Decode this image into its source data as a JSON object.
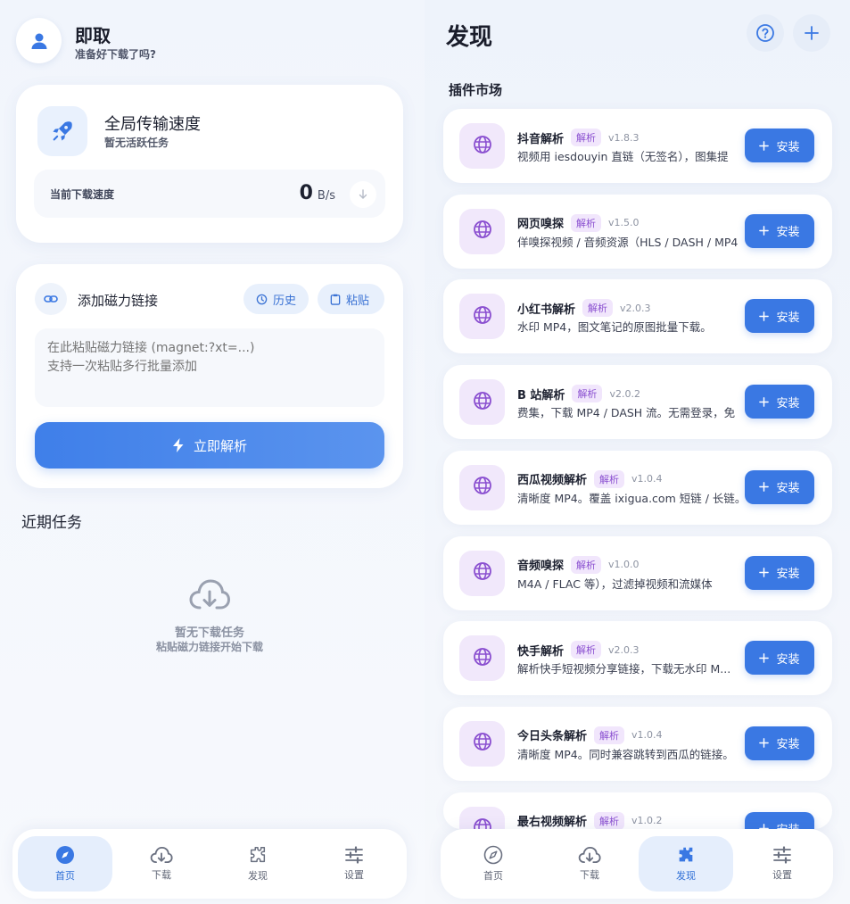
{
  "home": {
    "app_title": "即取",
    "app_subtitle": "准备好下载了吗?",
    "speed_card": {
      "title": "全局传输速度",
      "subtitle": "暂无活跃任务",
      "current_label": "当前下载速度",
      "speed_value": "0",
      "speed_unit": "B/s"
    },
    "magnet_card": {
      "title": "添加磁力链接",
      "history_label": "历史",
      "paste_label": "粘贴",
      "placeholder": "在此粘贴磁力链接 (magnet:?xt=...)\n支持一次粘贴多行批量添加",
      "parse_label": "立即解析"
    },
    "recent_title": "近期任务",
    "empty_main": "暂无下载任务",
    "empty_sub": "粘贴磁力链接开始下载"
  },
  "nav_left": [
    {
      "label": "首页",
      "icon": "compass-icon",
      "active": true
    },
    {
      "label": "下载",
      "icon": "cloud-download-icon",
      "active": false
    },
    {
      "label": "发现",
      "icon": "puzzle-icon",
      "active": false
    },
    {
      "label": "设置",
      "icon": "sliders-icon",
      "active": false
    }
  ],
  "discover": {
    "title": "发现",
    "market_title": "插件市场",
    "install_label": "安装",
    "plugins": [
      {
        "name": "抖音解析",
        "tag": "解析",
        "version": "v1.8.3",
        "desc": "视频用 iesdouyin 直链（无签名），图集提"
      },
      {
        "name": "网页嗅探",
        "tag": "解析",
        "version": "v1.5.0",
        "desc": "佯嗅探视频 / 音频资源（HLS / DASH / MP4"
      },
      {
        "name": "小红书解析",
        "tag": "解析",
        "version": "v2.0.3",
        "desc": "水印 MP4，图文笔记的原图批量下载。"
      },
      {
        "name": "B 站解析",
        "tag": "解析",
        "version": "v2.0.2",
        "desc": "费集，下载 MP4 / DASH 流。无需登录，免"
      },
      {
        "name": "西瓜视频解析",
        "tag": "解析",
        "version": "v1.0.4",
        "desc": "清晰度 MP4。覆盖 ixigua.com 短链 / 长链。"
      },
      {
        "name": "音频嗅探",
        "tag": "解析",
        "version": "v1.0.0",
        "desc": "M4A / FLAC 等），过滤掉视频和流媒体"
      },
      {
        "name": "快手解析",
        "tag": "解析",
        "version": "v2.0.3",
        "desc": "解析快手短视频分享链接，下载无水印 M..."
      },
      {
        "name": "今日头条解析",
        "tag": "解析",
        "version": "v1.0.4",
        "desc": "清晰度 MP4。同时兼容跳转到西瓜的链接。"
      },
      {
        "name": "最右视频解析",
        "tag": "解析",
        "version": "v1.0.2",
        "desc": ""
      }
    ]
  },
  "nav_right": [
    {
      "label": "首页",
      "icon": "compass-icon",
      "active": false
    },
    {
      "label": "下载",
      "icon": "cloud-download-icon",
      "active": false
    },
    {
      "label": "发现",
      "icon": "puzzle-icon",
      "active": true
    },
    {
      "label": "设置",
      "icon": "sliders-icon",
      "active": false
    }
  ],
  "colors": {
    "accent": "#3a78e3",
    "plugin_purple": "#8a4fd0",
    "active_nav_bg": "#e5eefc"
  }
}
